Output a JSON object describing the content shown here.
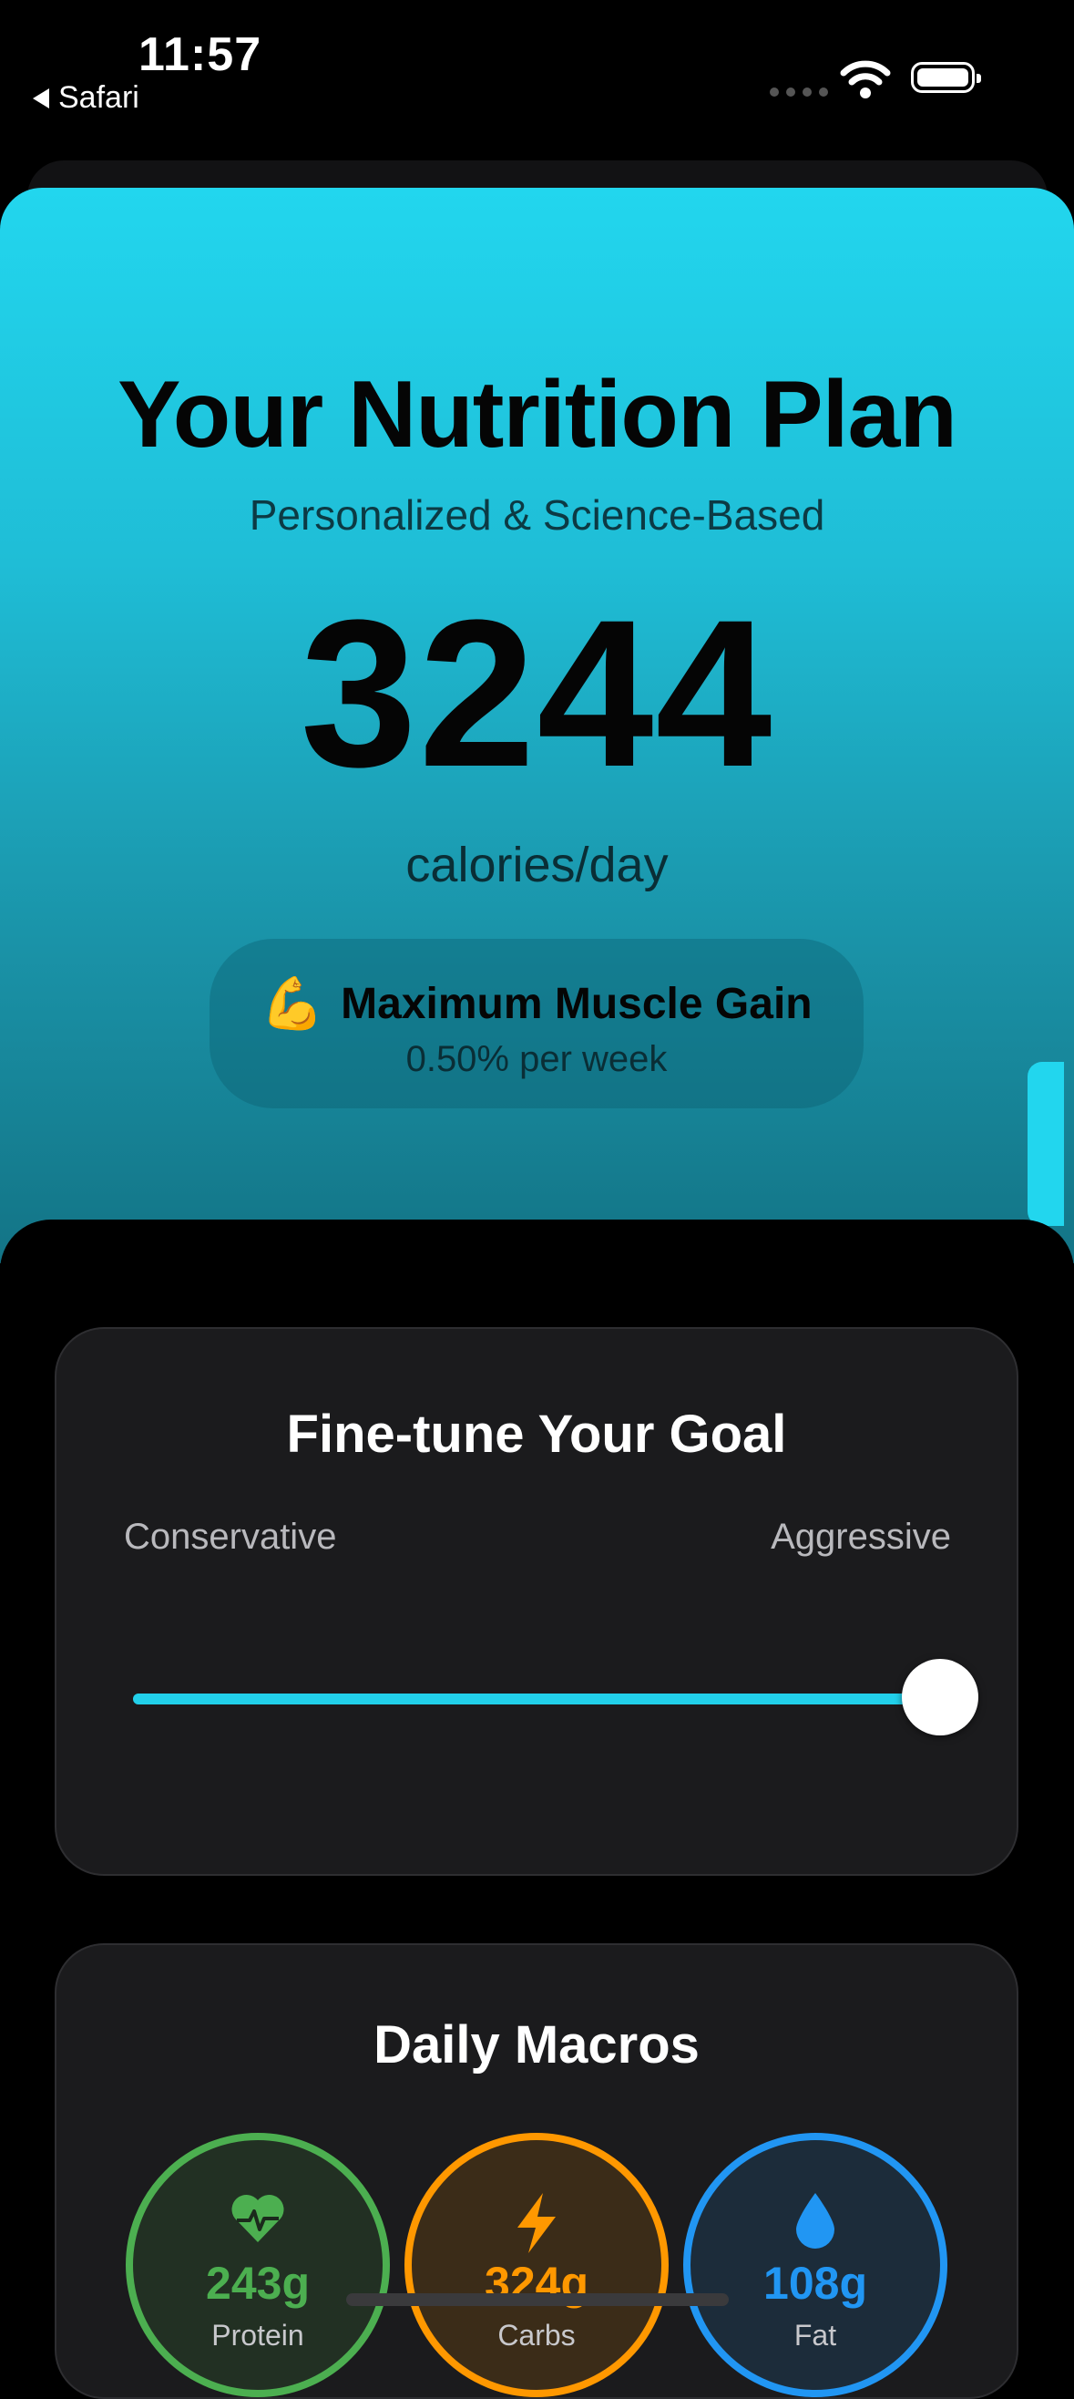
{
  "status_bar": {
    "time": "11:57",
    "back_app": "Safari"
  },
  "hero": {
    "title": "Your Nutrition Plan",
    "subtitle": "Personalized & Science-Based",
    "calories": "3244",
    "calories_unit": "calories/day",
    "goal": {
      "emoji": "💪",
      "name": "Maximum Muscle Gain",
      "rate": "0.50% per week"
    },
    "gradient_top": "#22d6ee",
    "gradient_bottom": "#137486"
  },
  "fine_tune": {
    "title": "Fine-tune Your Goal",
    "min_label": "Conservative",
    "max_label": "Aggressive",
    "slider_value": 1.0,
    "accent": "#22d0ea"
  },
  "daily_macros": {
    "title": "Daily Macros",
    "items": [
      {
        "icon": "heart-pulse-icon",
        "value": "243g",
        "label": "Protein",
        "color": "#4caf50"
      },
      {
        "icon": "lightning-icon",
        "value": "324g",
        "label": "Carbs",
        "color": "#ff9800"
      },
      {
        "icon": "droplet-icon",
        "value": "108g",
        "label": "Fat",
        "color": "#2196f3"
      }
    ]
  }
}
